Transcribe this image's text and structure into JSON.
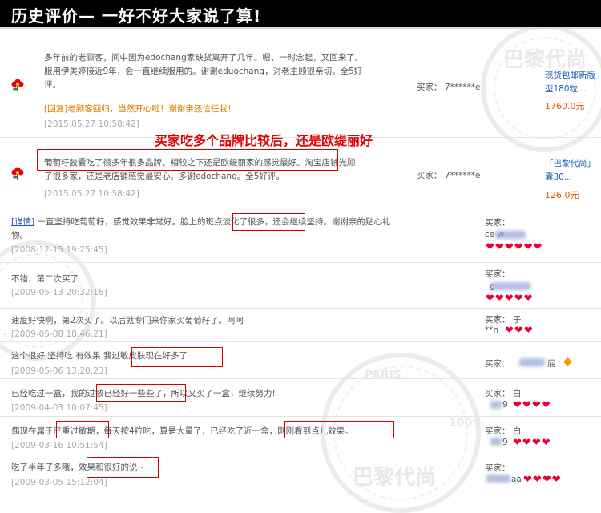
{
  "header": {
    "title": "历史评价— 一好不好大家说了算!"
  },
  "annotation": {
    "text": "买家吃多个品牌比较后，还是欧缇丽好"
  },
  "reviews_top": [
    {
      "text_line1": "多年前的老顾客，间中因为edochang家缺货离开了几年。嗯，一时念起，又回来了。",
      "text_line2": "服用伊美婷接近9年，会一直继续服用的。谢谢eduochang，对老主顾很亲切。全5好",
      "text_line3": "评。",
      "reply": "[回复]老顾客回归，当然开心啦！谢谢亲还信任我！",
      "date": "[2015.05.27 10:58:42]",
      "buyer": "买家：  7******e",
      "product_line1": "现货包邮新版",
      "product_line2": "型180粒...",
      "price": "1760.0元"
    },
    {
      "text_line1": "葡萄籽胶囊吃了很多年很多品牌，相较之下还是欧缇丽家的感觉最好。淘宝店铺光顾",
      "text_line2": "了很多家，还是老店铺感觉最安心。多谢edochang。全5好评。",
      "date": "[2015.05.27 10:58:42]",
      "buyer": "买家：  7******e",
      "product_line1": "「巴黎代尚」",
      "product_line2": "囊30...",
      "price": "126.0元"
    }
  ],
  "reviews": [
    {
      "detail": "[详情]",
      "line1": "一直坚持吃葡萄籽，感觉效果非常好。脸上的斑点淡化了很多，还会继续坚持。谢谢亲的贴心礼",
      "line2": "物。",
      "date": "[2008-12-15 19:25:45]",
      "buyer": "买家：",
      "buyer_id": "ce    w"
    },
    {
      "line1": "不错，第二次买了",
      "date": "[2009-05-13 20:32:16]",
      "buyer": "买家：",
      "buyer_id": "l        g"
    },
    {
      "line1": "速度好快啊，第2次买了。以后就专门来你家买葡萄籽了。呵呵",
      "date": "[2009-05-08 18:46:21]",
      "buyer": "买家：  子",
      "buyer_id": "**n"
    },
    {
      "line1": "这个很好  坚持吃  有效果  我过敏皮肤现在好多了",
      "date": "[2009-05-06 13:20:23]",
      "buyer": "买家：",
      "buyer_id": "屁"
    },
    {
      "line1": "已经吃过一盒，我的过敏已经好一些些了，所以又买了一盒，继续努力!",
      "date": "[2009-04-03 10:07:45]",
      "buyer": "买家：  白",
      "buyer_id": "9"
    },
    {
      "line1": "偶现在属于严重过敏期，每天按4粒吃，算是大量了，已经吃了近一盒，刚刚看到点儿效果。",
      "date": "[2009-03-16 10:51:54]",
      "buyer": "买家：  白",
      "buyer_id": "9"
    },
    {
      "line1": "吃了半年了多哦，效果和很好的说~",
      "date": "[2009-03-05 15:12:04]",
      "buyer": "买家：",
      "buyer_id": "aa"
    }
  ],
  "watermark": {
    "brand": "巴黎代尚",
    "paris": "PARIS",
    "percent": "100%"
  },
  "colors": {
    "accent_red": "#d40000",
    "link_blue": "#1a5db8",
    "price_orange": "#e05a00",
    "heart": "#e60033"
  }
}
